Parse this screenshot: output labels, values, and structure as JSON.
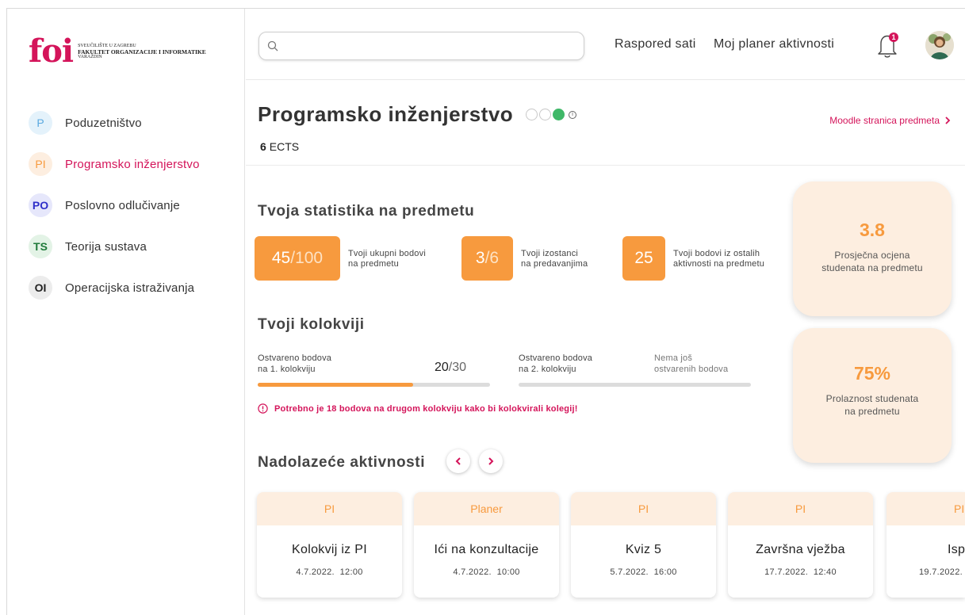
{
  "logo": {
    "word": "foi",
    "line1": "SVEUČILIŠTE U ZAGREBU",
    "line2": "FAKULTET ORGANIZACIJE I INFORMATIKE",
    "line3": "VARAŽDIN"
  },
  "sidebar": {
    "items": [
      {
        "abbr": "P",
        "label": "Poduzetništvo"
      },
      {
        "abbr": "PI",
        "label": "Programsko inženjerstvo"
      },
      {
        "abbr": "PO",
        "label": "Poslovno odlučivanje"
      },
      {
        "abbr": "TS",
        "label": "Teorija sustava"
      },
      {
        "abbr": "OI",
        "label": "Operacijska istraživanja"
      }
    ]
  },
  "header": {
    "search_placeholder": "",
    "link_schedule": "Raspored sati",
    "link_planner": "Moj planer aktivnosti",
    "notification_count": "1"
  },
  "course": {
    "title": "Programsko inženjerstvo",
    "difficulty_level": "3 of 3",
    "ects_value": "6",
    "ects_label": "ECTS",
    "moodle_link": "Moodle stranica predmeta"
  },
  "stats": {
    "title": "Tvoja statistika na predmetu",
    "points": {
      "value": "45",
      "max": "/100",
      "label_1": "Tvoji ukupni bodovi",
      "label_2": "na predmetu"
    },
    "absences": {
      "value": "3",
      "max": "/6",
      "label_1": "Tvoji izostanci",
      "label_2": "na predavanjima"
    },
    "other": {
      "value": "25",
      "label_1": "Tvoji bodovi iz ostalih",
      "label_2": "aktivnosti na predmetu"
    }
  },
  "side_cards": {
    "average": {
      "value": "3.8",
      "line1": "Prosječna ocjena",
      "line2": "studenata na predmetu"
    },
    "pass_rate": {
      "value": "75%",
      "line1": "Prolaznost studenata",
      "line2": "na predmetu"
    }
  },
  "colloquia": {
    "title": "Tvoji kolokviji",
    "first": {
      "label_1": "Ostvareno bodova",
      "label_2": "na 1. kolokviju",
      "score": "20",
      "max": "/30",
      "progress": 0.67
    },
    "second": {
      "label_1": "Ostvareno bodova",
      "label_2": "na 2. kolokviju",
      "status_1": "Nema još",
      "status_2": "ostvarenih bodova",
      "progress": 0
    },
    "warning": "Potrebno je 18 bodova na drugom kolokviju kako bi kolokvirali kolegij!"
  },
  "activities": {
    "title": "Nadolazeće aktivnosti",
    "items": [
      {
        "tag": "PI",
        "name": "Kolokvij iz PI",
        "date": "4.7.2022.",
        "time": "12:00"
      },
      {
        "tag": "Planer",
        "name": "Ići na konzultacije",
        "date": "4.7.2022.",
        "time": "10:00"
      },
      {
        "tag": "PI",
        "name": "Kviz 5",
        "date": "5.7.2022.",
        "time": "16:00"
      },
      {
        "tag": "PI",
        "name": "Završna vježba",
        "date": "17.7.2022.",
        "time": "12:40"
      },
      {
        "tag": "PI",
        "name": "Isp",
        "date": "19.7.2022.",
        "time": ""
      }
    ]
  },
  "colors": {
    "accent": "#d4145a",
    "orange": "#f79a3e",
    "peach": "#fdeee0",
    "green": "#3fb868"
  }
}
